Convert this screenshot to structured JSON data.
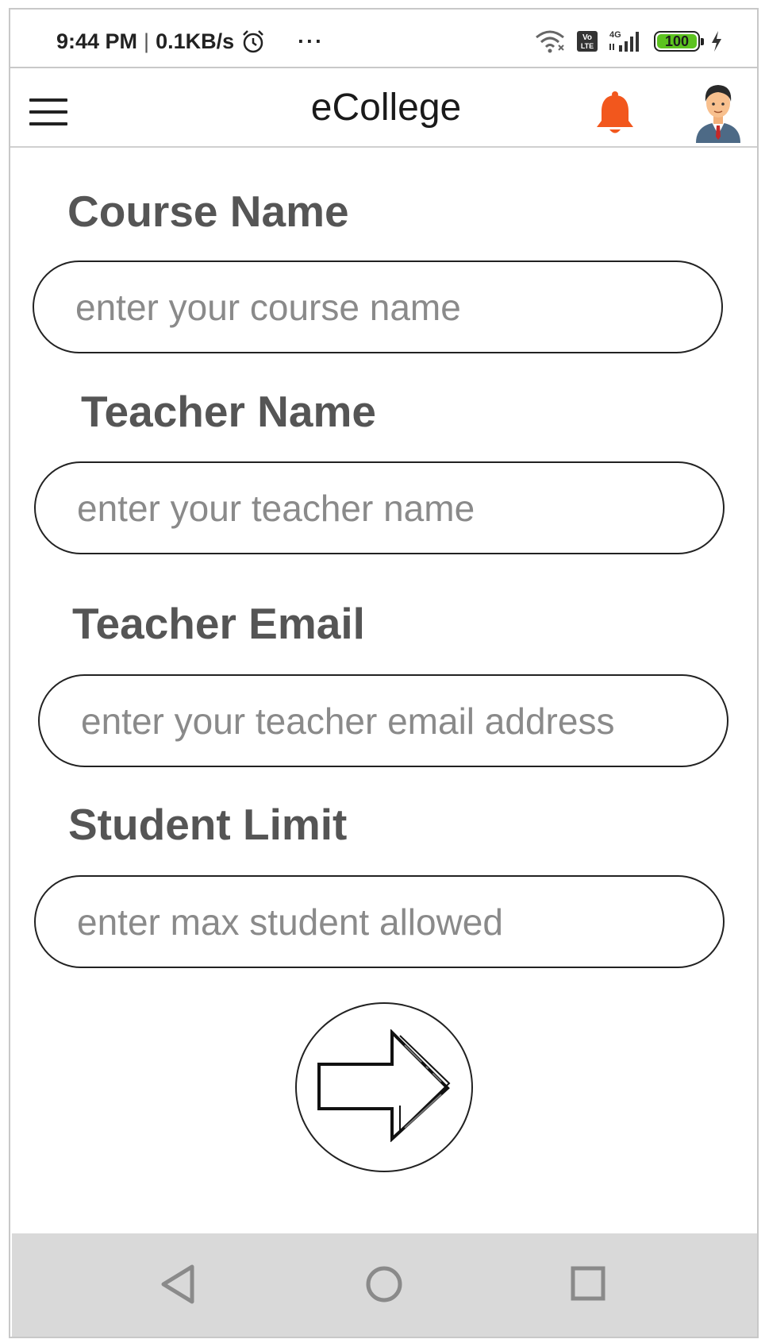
{
  "status_bar": {
    "time": "9:44 PM",
    "separator": "|",
    "net_speed": "0.1KB/s",
    "overflow": "···",
    "network_type": "4G",
    "volte": "Vo LTE",
    "battery": "100"
  },
  "app_bar": {
    "title": "eCollege"
  },
  "form": {
    "course_name": {
      "label": "Course Name",
      "placeholder": "enter your course name"
    },
    "teacher_name": {
      "label": "Teacher Name",
      "placeholder": "enter your teacher name"
    },
    "teacher_email": {
      "label": "Teacher Email",
      "placeholder": "enter your teacher email address"
    },
    "student_limit": {
      "label": "Student Limit",
      "placeholder": "enter max student allowed"
    }
  },
  "colors": {
    "bell": "#f2571d",
    "battery_fill": "#5cc21f",
    "label_text": "#555555",
    "placeholder_text": "#8a8a8a",
    "nav_bar": "#d9d9d9"
  },
  "icons": {
    "menu": "hamburger-menu-icon",
    "notifications": "bell-icon",
    "profile": "avatar-businessman",
    "submit": "arrow-right-icon",
    "nav_back": "triangle-back-icon",
    "nav_home": "circle-home-icon",
    "nav_recents": "square-recents-icon"
  }
}
